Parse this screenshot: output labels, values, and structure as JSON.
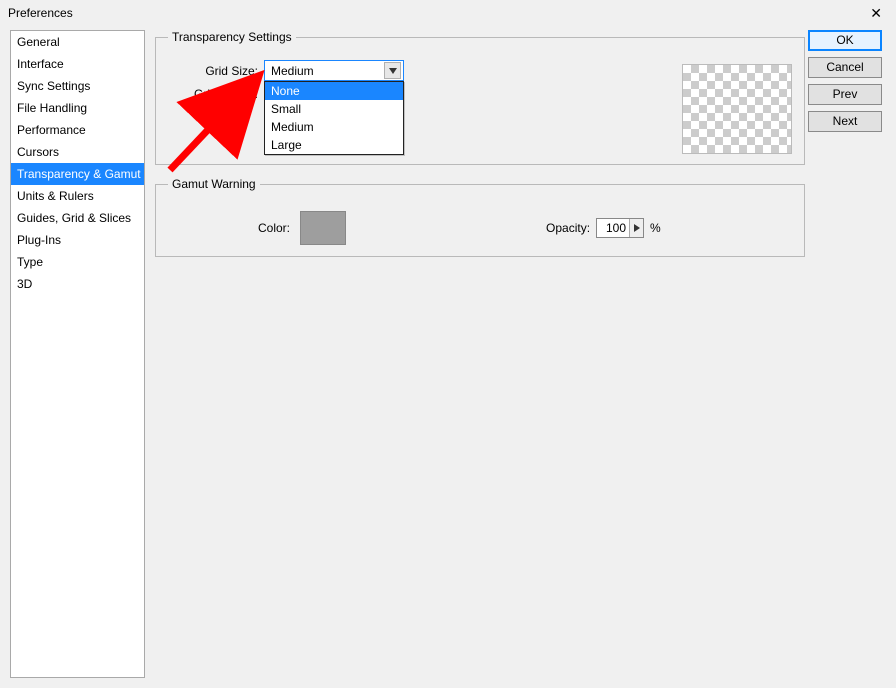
{
  "window": {
    "title": "Preferences"
  },
  "sidebar": {
    "items": [
      {
        "label": "General"
      },
      {
        "label": "Interface"
      },
      {
        "label": "Sync Settings"
      },
      {
        "label": "File Handling"
      },
      {
        "label": "Performance"
      },
      {
        "label": "Cursors"
      },
      {
        "label": "Transparency & Gamut",
        "selected": true
      },
      {
        "label": "Units & Rulers"
      },
      {
        "label": "Guides, Grid & Slices"
      },
      {
        "label": "Plug-Ins"
      },
      {
        "label": "Type"
      },
      {
        "label": "3D"
      }
    ]
  },
  "buttons": {
    "ok": "OK",
    "cancel": "Cancel",
    "prev": "Prev",
    "next": "Next"
  },
  "transparency": {
    "legend": "Transparency Settings",
    "grid_size_label": "Grid Size:",
    "grid_size_value": "Medium",
    "grid_size_options": [
      "None",
      "Small",
      "Medium",
      "Large"
    ],
    "grid_size_highlight": "None",
    "grid_colors_label": "Grid Colors:"
  },
  "gamut": {
    "legend": "Gamut Warning",
    "color_label": "Color:",
    "color_value": "#9e9e9e",
    "opacity_label": "Opacity:",
    "opacity_value": "100",
    "opacity_suffix": "%"
  }
}
